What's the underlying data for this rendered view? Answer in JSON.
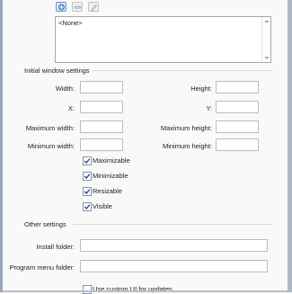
{
  "toolbar": {
    "icons": [
      "add-icon",
      "remove-icon",
      "edit-icon"
    ]
  },
  "list": {
    "items": [
      "<None>"
    ]
  },
  "initial_window": {
    "heading": "Initial window settings",
    "width_label": "Width:",
    "height_label": "Height:",
    "x_label": "X:",
    "y_label": "Y:",
    "max_width_label": "Maximum width:",
    "max_height_label": "Maximum height:",
    "min_width_label": "Minimum width:",
    "min_height_label": "Minimum height:",
    "width": "",
    "height": "",
    "x": "",
    "y": "",
    "max_width": "",
    "max_height": "",
    "min_width": "",
    "min_height": "",
    "checks": [
      {
        "label": "Maximizable",
        "checked": true
      },
      {
        "label": "Minimizable",
        "checked": true
      },
      {
        "label": "Resizable",
        "checked": true
      },
      {
        "label": "Visible",
        "checked": true
      }
    ]
  },
  "other": {
    "heading": "Other settings",
    "install_folder_label": "Install folder:",
    "install_folder": "",
    "program_menu_label": "Program menu folder:",
    "program_menu": "",
    "custom_ui": {
      "label": "Use custom UI for updates",
      "checked": false
    }
  },
  "colors": {
    "check": "#1f3f8f",
    "frame": "#9aa6b4"
  }
}
